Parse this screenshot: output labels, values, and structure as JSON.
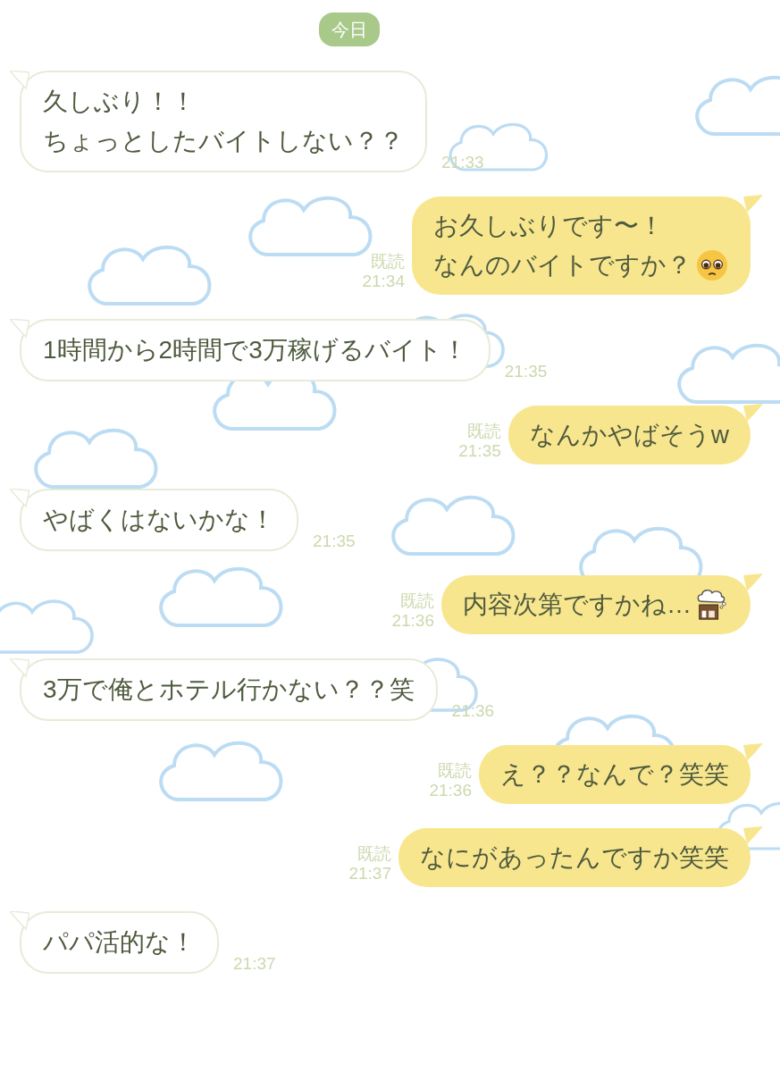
{
  "date_label": "今日",
  "messages": [
    {
      "kind": "incoming",
      "lines": [
        "久しぶり！！",
        "ちょっとしたバイトしない？？"
      ],
      "time": "21:33"
    },
    {
      "kind": "outgoing",
      "lines": [
        "お久しぶりです〜！",
        "なんのバイトですか？"
      ],
      "read_label": "既読",
      "time": "21:34"
    },
    {
      "kind": "incoming",
      "lines": [
        "1時間から2時間で3万稼げるバイト！"
      ],
      "time": "21:35"
    },
    {
      "kind": "outgoing",
      "lines": [
        "なんかやばそうw"
      ],
      "read_label": "既読",
      "time": "21:35"
    },
    {
      "kind": "incoming",
      "lines": [
        "やばくはないかな！"
      ],
      "time": "21:35"
    },
    {
      "kind": "outgoing",
      "lines": [
        "内容次第ですかね…"
      ],
      "read_label": "既読",
      "time": "21:36"
    },
    {
      "kind": "incoming",
      "lines": [
        "3万で俺とホテル行かない？？笑"
      ],
      "time": "21:36"
    },
    {
      "kind": "outgoing",
      "lines": [
        "え？？なんで？笑笑"
      ],
      "read_label": "既読",
      "time": "21:36"
    },
    {
      "kind": "outgoing",
      "lines": [
        "なにがあったんですか笑笑"
      ],
      "read_label": "既読",
      "time": "21:37"
    },
    {
      "kind": "incoming",
      "lines": [
        "パパ活的な！"
      ],
      "time": "21:37"
    }
  ]
}
